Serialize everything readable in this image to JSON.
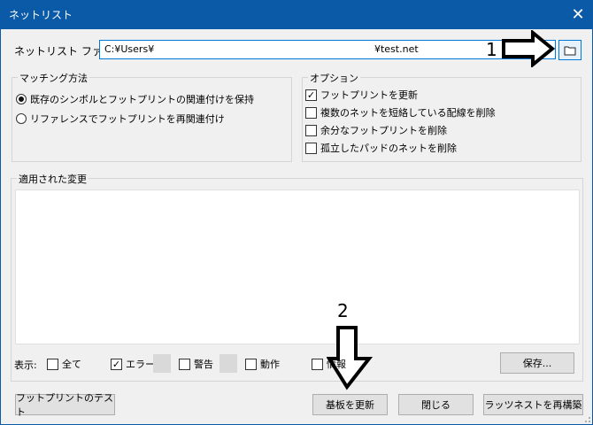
{
  "window": {
    "title": "ネットリスト",
    "close_glyph": "✕"
  },
  "file": {
    "label": "ネットリスト ファイル:",
    "value_start": "C:¥Users¥",
    "value_end": "¥test.net"
  },
  "matching": {
    "title": "マッチング方法",
    "options": [
      {
        "label": "既存のシンボルとフットプリントの関連付けを保持",
        "selected": true
      },
      {
        "label": "リファレンスでフットプリントを再関連付け",
        "selected": false
      }
    ]
  },
  "options": {
    "title": "オプション",
    "items": [
      {
        "label": "フットプリントを更新",
        "checked": true
      },
      {
        "label": "複数のネットを短絡している配線を削除",
        "checked": false
      },
      {
        "label": "余分なフットプリントを削除",
        "checked": false
      },
      {
        "label": "孤立したパッドのネットを削除",
        "checked": false
      }
    ]
  },
  "changes": {
    "title": "適用された変更"
  },
  "filter": {
    "label": "表示:",
    "all": "全て",
    "error": "エラー",
    "warning": "警告",
    "action": "動作",
    "info": "情報",
    "save": "保存..."
  },
  "buttons": {
    "test_footprint": "フットプリントのテスト",
    "update_board": "基板を更新",
    "close": "閉じる",
    "rebuild_ratsnest": "ラッツネストを再構築"
  },
  "annotations": {
    "one": "1",
    "two": "2"
  },
  "icons": {
    "browse": "folder-icon",
    "close": "close-icon"
  },
  "colors": {
    "titlebar": "#0a5aa8",
    "focus": "#0078d7"
  }
}
